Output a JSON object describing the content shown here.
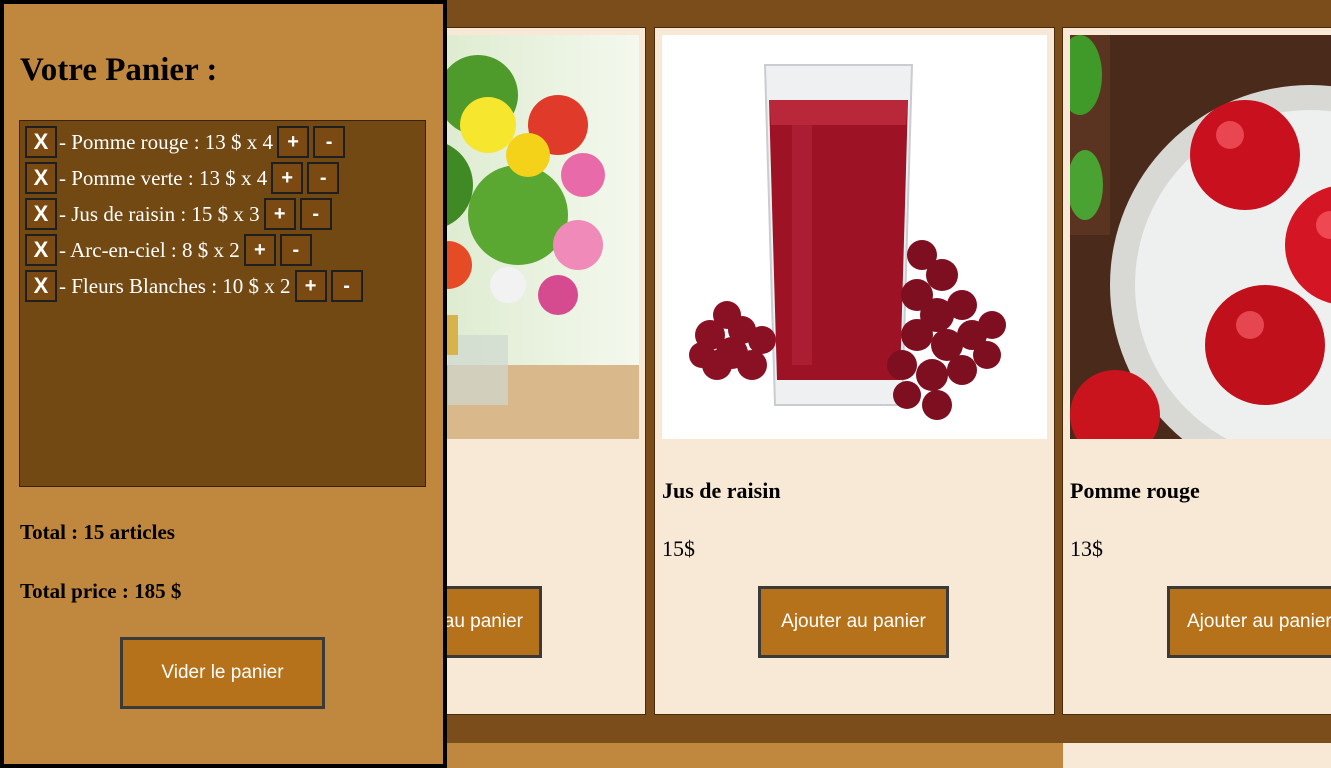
{
  "cart": {
    "title": "Votre Panier :",
    "items": [
      {
        "remove": "X",
        "text": "- Pomme rouge : 13 $ x 4",
        "plus": "+",
        "minus": "-"
      },
      {
        "remove": "X",
        "text": "- Pomme verte : 13 $ x 4",
        "plus": "+",
        "minus": "-"
      },
      {
        "remove": "X",
        "text": "- Jus de raisin : 15 $ x 3",
        "plus": "+",
        "minus": "-"
      },
      {
        "remove": "X",
        "text": "- Arc-en-ciel : 8 $ x 2",
        "plus": "+",
        "minus": "-"
      },
      {
        "remove": "X",
        "text": "- Fleurs Blanches : 10 $ x 2",
        "plus": "+",
        "minus": "-"
      }
    ],
    "total_articles": "Total : 15 articles",
    "total_price": "Total price : 185 $",
    "clear_label": "Vider le panier"
  },
  "products": [
    {
      "name": "",
      "price": "",
      "button": "Ajouter au panier",
      "image": "flower-bouquet-image"
    },
    {
      "name": "Jus de raisin",
      "price": "15$",
      "button": "Ajouter au panier",
      "image": "grape-juice-image"
    },
    {
      "name": "Pomme rouge",
      "price": "13$",
      "button": "Ajouter au panier",
      "image": "red-apples-image"
    }
  ],
  "colors": {
    "page_bg": "#7a4d1b",
    "panel_bg": "#c0873f",
    "list_bg": "#724813",
    "card_bg": "#f8e9d6",
    "button_bg": "#b5721b"
  }
}
